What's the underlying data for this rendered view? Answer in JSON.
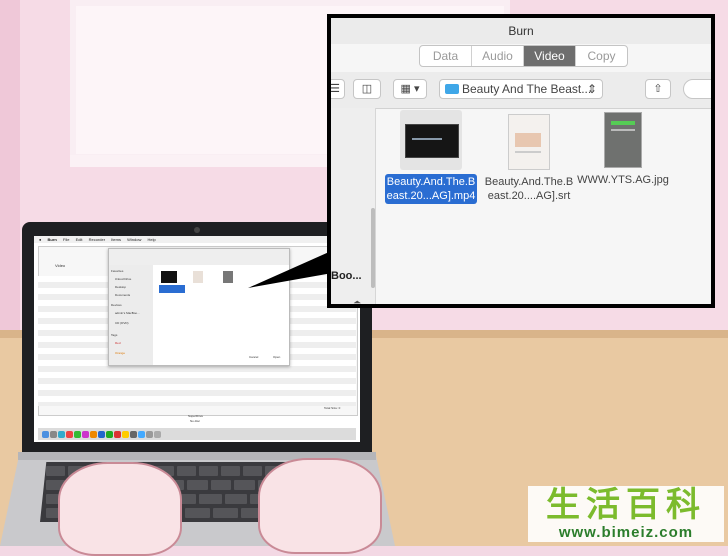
{
  "zoom_window": {
    "title": "Burn",
    "tabs": [
      {
        "label": "Data",
        "active": false
      },
      {
        "label": "Audio",
        "active": false
      },
      {
        "label": "Video",
        "active": true
      },
      {
        "label": "Copy",
        "active": false
      }
    ],
    "location": "Beauty And The Beast...",
    "sidebar_fragment": "Boo...",
    "files": [
      {
        "label": "Beauty.And.The.Beast.20...AG].mp4",
        "line1": "Beauty.And.The.B",
        "line2": "east.20...AG].mp4",
        "selected": true,
        "icon": "video-file-icon"
      },
      {
        "label": "Beauty.And.The.Beast.20....AG].srt",
        "line1": "Beauty.And.The.B",
        "line2": "east.20....AG].srt",
        "selected": false,
        "icon": "text-file-icon"
      },
      {
        "label": "WWW.YTS.AG.jpg",
        "line1": "WWW.YTS.AG.jpg",
        "line2": "",
        "selected": false,
        "icon": "image-file-icon"
      }
    ],
    "accent_color": "#2a6dd2"
  },
  "laptop_screen": {
    "menu": [
      "Burn",
      "File",
      "Edit",
      "Recorder",
      "Items",
      "Window",
      "Help"
    ],
    "clock": "Wed 2",
    "disc_name": "Video",
    "sidebar_sections": {
      "favorites_header": "Favorites",
      "favorites": [
        "iCloud Drive",
        "Desktop",
        "Documents"
      ],
      "devices_header": "Devices",
      "devices": [
        "admin's MacBoo...",
        "CD (DVD)"
      ],
      "tags_header": "Tags",
      "tags": [
        "Red",
        "Orange"
      ]
    },
    "sheet_buttons": {
      "cancel": "Cancel",
      "open": "Open"
    },
    "status": {
      "title": "SuperDrive",
      "subtitle": "No disc"
    },
    "size_label": "Total Size: 0"
  },
  "watermark": {
    "chinese": "生活百科",
    "url": "www.bimeiz.com"
  }
}
